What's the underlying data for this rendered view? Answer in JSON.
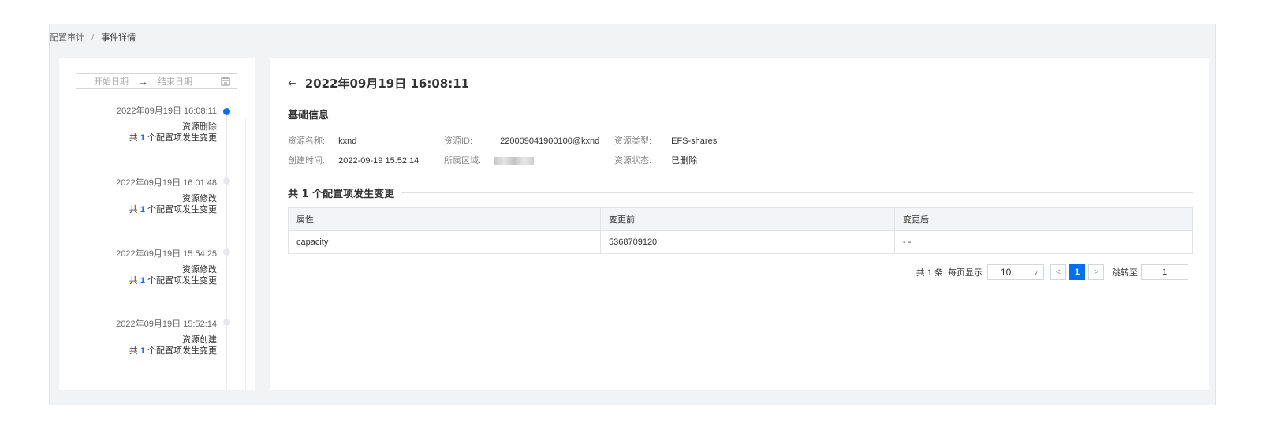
{
  "breadcrumb": {
    "parent": "配置审计",
    "separator": "/",
    "current": "事件详情"
  },
  "date_range": {
    "start_placeholder": "开始日期",
    "end_placeholder": "结束日期",
    "arrow": "→",
    "icon": "calendar-icon"
  },
  "timeline": [
    {
      "time": "2022年09月19日 16:08:11",
      "action": "资源删除",
      "prefix": "共",
      "count": "1",
      "suffix": "个配置项发生变更",
      "active": true
    },
    {
      "time": "2022年09月19日 16:01:48",
      "action": "资源修改",
      "prefix": "共",
      "count": "1",
      "suffix": "个配置项发生变更",
      "active": false
    },
    {
      "time": "2022年09月19日 15:54:25",
      "action": "资源修改",
      "prefix": "共",
      "count": "1",
      "suffix": "个配置项发生变更",
      "active": false
    },
    {
      "time": "2022年09月19日 15:52:14",
      "action": "资源创建",
      "prefix": "共",
      "count": "1",
      "suffix": "个配置项发生变更",
      "active": false
    }
  ],
  "detail": {
    "back_icon": "←",
    "title": "2022年09月19日 16:08:11",
    "basic_section": "基础信息",
    "fields": {
      "name_label": "资源名称:",
      "name_value": "kxnd",
      "id_label": "资源ID:",
      "id_value": "220009041900100@kxnd",
      "type_label": "资源类型:",
      "type_value": "EFS-shares",
      "created_label": "创建时间:",
      "created_value": "2022-09-19 15:52:14",
      "region_label": "所属区域:",
      "status_label": "资源状态:",
      "status_value": "已删除"
    },
    "changes_section": "共 1 个配置项发生变更",
    "table": {
      "headers": [
        "属性",
        "变更前",
        "变更后"
      ],
      "rows": [
        [
          "capacity",
          "5368709120",
          "- -"
        ]
      ]
    },
    "pagination": {
      "total_text": "共 1 条",
      "per_page_label": "每页显示",
      "page_size": "10",
      "prev": "<",
      "current_page": "1",
      "next": ">",
      "jump_label": "跳转至",
      "jump_value": "1"
    }
  }
}
